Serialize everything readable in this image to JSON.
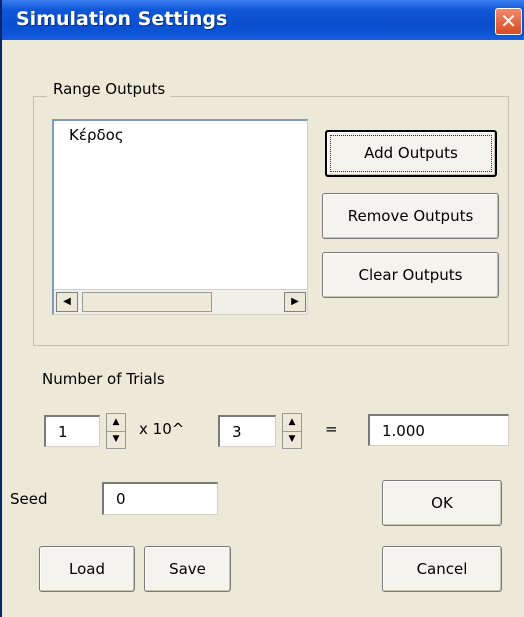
{
  "window": {
    "title": "Simulation Settings",
    "close_glyph": "✕"
  },
  "range_outputs": {
    "legend": "Range Outputs",
    "items": [
      "Κέρδος"
    ],
    "scroll_left_glyph": "◀",
    "scroll_right_glyph": "▶",
    "add_label": "Add Outputs",
    "remove_label": "Remove Outputs",
    "clear_label": "Clear Outputs"
  },
  "trials": {
    "label": "Number of Trials",
    "mantissa": "1",
    "times_label": "x 10^",
    "exponent": "3",
    "equals": "=",
    "result": "1.000",
    "up_glyph": "▲",
    "down_glyph": "▼"
  },
  "seed": {
    "label": "Seed",
    "value": "0"
  },
  "buttons": {
    "ok": "OK",
    "load": "Load",
    "save": "Save",
    "cancel": "Cancel"
  }
}
